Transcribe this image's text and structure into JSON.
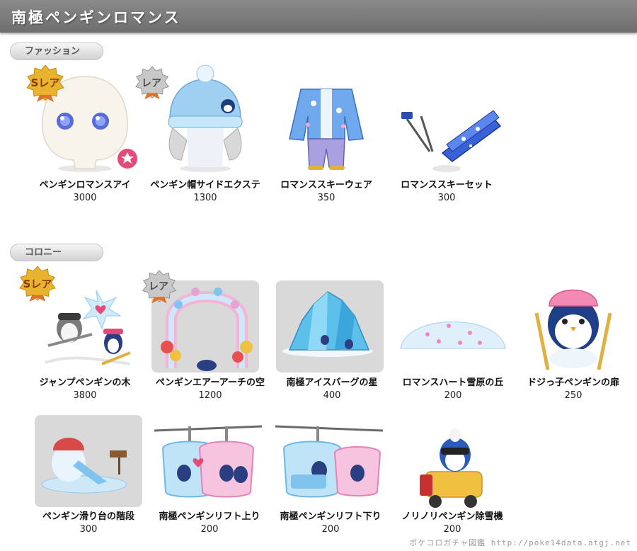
{
  "title": "南極ペンギンロマンス",
  "sections": {
    "fashion": {
      "label": "ファッション",
      "items": [
        {
          "name": "ペンギンロマンスアイ",
          "price": "3000",
          "badge": "Sレア"
        },
        {
          "name": "ペンギン帽サイドエクステ",
          "price": "1300",
          "badge": "レア"
        },
        {
          "name": "ロマンススキーウェア",
          "price": "350",
          "badge": ""
        },
        {
          "name": "ロマンススキーセット",
          "price": "300",
          "badge": ""
        }
      ]
    },
    "colony": {
      "label": "コロニー",
      "items": [
        {
          "name": "ジャンプペンギンの木",
          "price": "3800",
          "badge": "Sレア"
        },
        {
          "name": "ペンギンエアーアーチの空",
          "price": "1200",
          "badge": "レア"
        },
        {
          "name": "南極アイスバーグの星",
          "price": "400",
          "badge": ""
        },
        {
          "name": "ロマンスハート雪原の丘",
          "price": "200",
          "badge": ""
        },
        {
          "name": "ドジっ子ペンギンの扉",
          "price": "250",
          "badge": ""
        },
        {
          "name": "ペンギン滑り台の階段",
          "price": "300",
          "badge": ""
        },
        {
          "name": "南極ペンギンリフト上り",
          "price": "200",
          "badge": ""
        },
        {
          "name": "南極ペンギンリフト下り",
          "price": "200",
          "badge": ""
        },
        {
          "name": "ノリノリペンギン除雪機",
          "price": "200",
          "badge": ""
        }
      ]
    }
  },
  "footer": "ポケコロガチャ図鑑 http://poke14data.atgj.net",
  "colors": {
    "title_bar": "#777777",
    "ice_blue": "#6ec6f0",
    "pink": "#f28ab4",
    "gold": "#e8b430",
    "silver": "#b8b8b8"
  }
}
